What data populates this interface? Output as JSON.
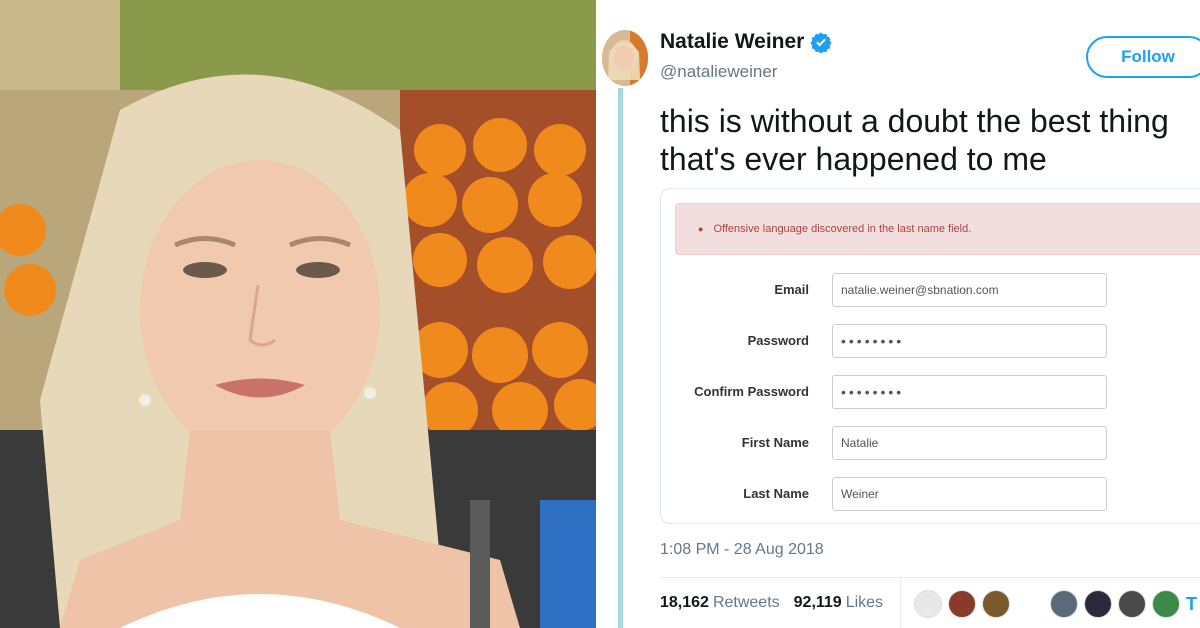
{
  "tweet": {
    "display_name": "Natalie Weiner",
    "handle": "@natalieweiner",
    "follow_label": "Follow",
    "text": "this is without a doubt the best thing that's ever happened to me",
    "timestamp": "1:08 PM - 28 Aug 2018",
    "retweets_count": "18,162",
    "retweets_label": "Retweets",
    "likes_count": "92,119",
    "likes_label": "Likes",
    "more_indicator": "T",
    "verified_icon": "verified-badge-icon",
    "accent_color": "#1da1f2"
  },
  "form": {
    "error_message": "Offensive language discovered in the last name field.",
    "fields": [
      {
        "label": "Email",
        "value": "natalie.weiner@sbnation.com"
      },
      {
        "label": "Password",
        "value": "••••••••"
      },
      {
        "label": "Confirm Password",
        "value": "••••••••"
      },
      {
        "label": "First Name",
        "value": "Natalie"
      },
      {
        "label": "Last Name",
        "value": "Weiner"
      }
    ]
  }
}
